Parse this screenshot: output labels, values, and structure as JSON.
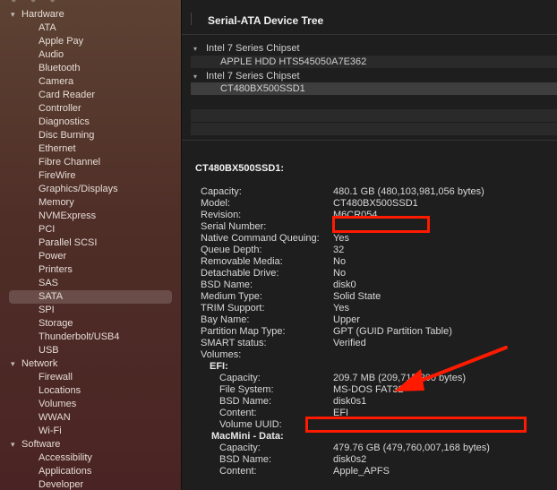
{
  "sidebar": {
    "groups": [
      {
        "label": "Hardware",
        "items": [
          "ATA",
          "Apple Pay",
          "Audio",
          "Bluetooth",
          "Camera",
          "Card Reader",
          "Controller",
          "Diagnostics",
          "Disc Burning",
          "Ethernet",
          "Fibre Channel",
          "FireWire",
          "Graphics/Displays",
          "Memory",
          "NVMExpress",
          "PCI",
          "Parallel SCSI",
          "Power",
          "Printers",
          "SAS",
          "SATA",
          "SPI",
          "Storage",
          "Thunderbolt/USB4",
          "USB"
        ]
      },
      {
        "label": "Network",
        "items": [
          "Firewall",
          "Locations",
          "Volumes",
          "WWAN",
          "Wi-Fi"
        ]
      },
      {
        "label": "Software",
        "items": [
          "Accessibility",
          "Applications",
          "Developer"
        ]
      }
    ],
    "selected": "SATA",
    "chevron": "chevron-down-icon"
  },
  "tree": {
    "title": "Serial-ATA Device Tree",
    "rows": [
      {
        "label": "Intel 7 Series Chipset",
        "kind": "chipset"
      },
      {
        "label": "APPLE HDD HTS545050A7E362",
        "kind": "device"
      },
      {
        "label": "Intel 7 Series Chipset",
        "kind": "chipset"
      },
      {
        "label": "CT480BX500SSD1",
        "kind": "device",
        "selected": true
      }
    ]
  },
  "detail": {
    "title": "CT480BX500SSD1:",
    "fields": [
      {
        "k": "Capacity:",
        "v": "480.1 GB (480,103,981,056 bytes)"
      },
      {
        "k": "Model:",
        "v": "CT480BX500SSD1"
      },
      {
        "k": "Revision:",
        "v": "M6CR054"
      },
      {
        "k": "Serial Number:",
        "v": ""
      },
      {
        "k": "Native Command Queuing:",
        "v": "Yes"
      },
      {
        "k": "Queue Depth:",
        "v": "32"
      },
      {
        "k": "Removable Media:",
        "v": "No"
      },
      {
        "k": "Detachable Drive:",
        "v": "No"
      },
      {
        "k": "BSD Name:",
        "v": "disk0"
      },
      {
        "k": "Medium Type:",
        "v": "Solid State"
      },
      {
        "k": "TRIM Support:",
        "v": "Yes"
      },
      {
        "k": "Bay Name:",
        "v": "Upper"
      },
      {
        "k": "Partition Map Type:",
        "v": "GPT (GUID Partition Table)"
      },
      {
        "k": "SMART status:",
        "v": "Verified"
      },
      {
        "k": "Volumes:",
        "v": ""
      }
    ],
    "volumes": [
      {
        "name": "EFI:",
        "fields": [
          {
            "k": "Capacity:",
            "v": "209.7 MB (209,715,200 bytes)"
          },
          {
            "k": "File System:",
            "v": "MS-DOS FAT32"
          },
          {
            "k": "BSD Name:",
            "v": "disk0s1"
          },
          {
            "k": "Content:",
            "v": "EFI"
          },
          {
            "k": "Volume UUID:",
            "v": ""
          }
        ]
      },
      {
        "name": "MacMini - Data:",
        "fields": [
          {
            "k": "Capacity:",
            "v": "479.76 GB (479,760,007,168 bytes)"
          },
          {
            "k": "BSD Name:",
            "v": "disk0s2"
          },
          {
            "k": "Content:",
            "v": "Apple_APFS"
          }
        ]
      }
    ]
  },
  "annotation": {
    "color": "#ff1a00"
  }
}
